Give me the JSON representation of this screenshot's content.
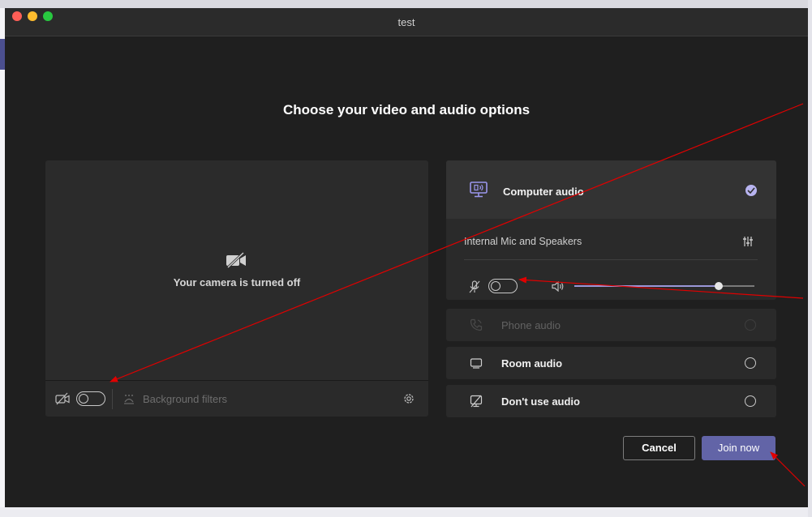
{
  "window": {
    "title": "test"
  },
  "heading": "Choose your video and audio options",
  "video": {
    "camera_status": "Your camera is turned off",
    "camera_toggle_on": false,
    "background_filters_label": "Background filters"
  },
  "audio": {
    "computer_audio_label": "Computer audio",
    "computer_audio_selected": true,
    "device_label": "Internal Mic and Speakers",
    "mic_toggle_on": false,
    "speaker_volume": 0.8,
    "options": [
      {
        "label": "Phone audio",
        "enabled": false
      },
      {
        "label": "Room audio",
        "enabled": true
      },
      {
        "label": "Don't use audio",
        "enabled": true
      }
    ]
  },
  "buttons": {
    "cancel": "Cancel",
    "join": "Join now"
  },
  "colors": {
    "accent": "#6264a7",
    "annotation_arrow": "#e00000",
    "selected_check": "#b8b4f0"
  }
}
